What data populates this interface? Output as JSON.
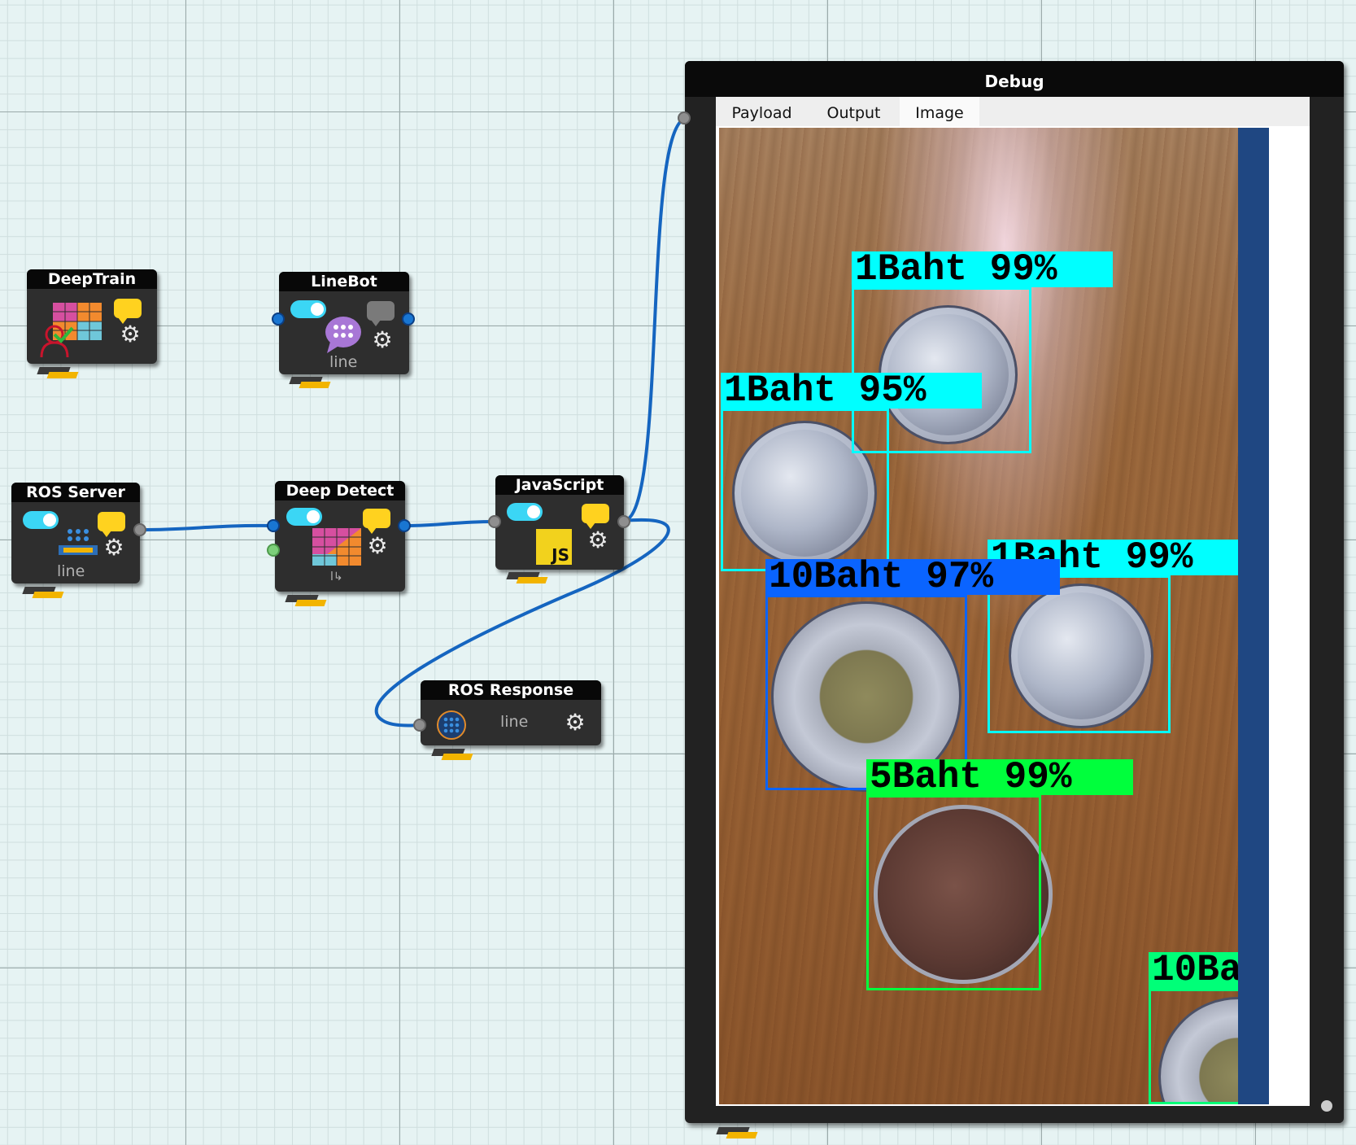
{
  "nodes": {
    "deeptrain": {
      "title": "DeepTrain"
    },
    "linebot": {
      "title": "LineBot",
      "subtitle": "line"
    },
    "ros_server": {
      "title": "ROS Server",
      "subtitle": "line"
    },
    "deep_detect": {
      "title": "Deep Detect",
      "subtitle": "l↳"
    },
    "javascript": {
      "title": "JavaScript",
      "badge": "JS"
    },
    "ros_response": {
      "title": "ROS Response",
      "subtitle": "line"
    }
  },
  "debug": {
    "title": "Debug",
    "tabs": [
      {
        "label": "Payload",
        "active": false
      },
      {
        "label": "Output",
        "active": false
      },
      {
        "label": "Image",
        "active": true
      }
    ],
    "detections": [
      {
        "label": "1Baht 99%",
        "color": "#00ffff"
      },
      {
        "label": "1Baht 95%",
        "color": "#00ffff"
      },
      {
        "label": "1Baht 99%",
        "color": "#00ffff"
      },
      {
        "label": "10Baht 97%",
        "color": "#0a64ff"
      },
      {
        "label": "5Baht 99%",
        "color": "#00ff3c"
      },
      {
        "label": "10Ba",
        "color": "#00ff78"
      }
    ]
  },
  "colors": {
    "wire": "#1565c0",
    "toggle": "#3bd6f5",
    "note_bubble": "#ffd21f",
    "canvas_bg": "#e6f3f3",
    "scrollbar": "#1f4782"
  }
}
